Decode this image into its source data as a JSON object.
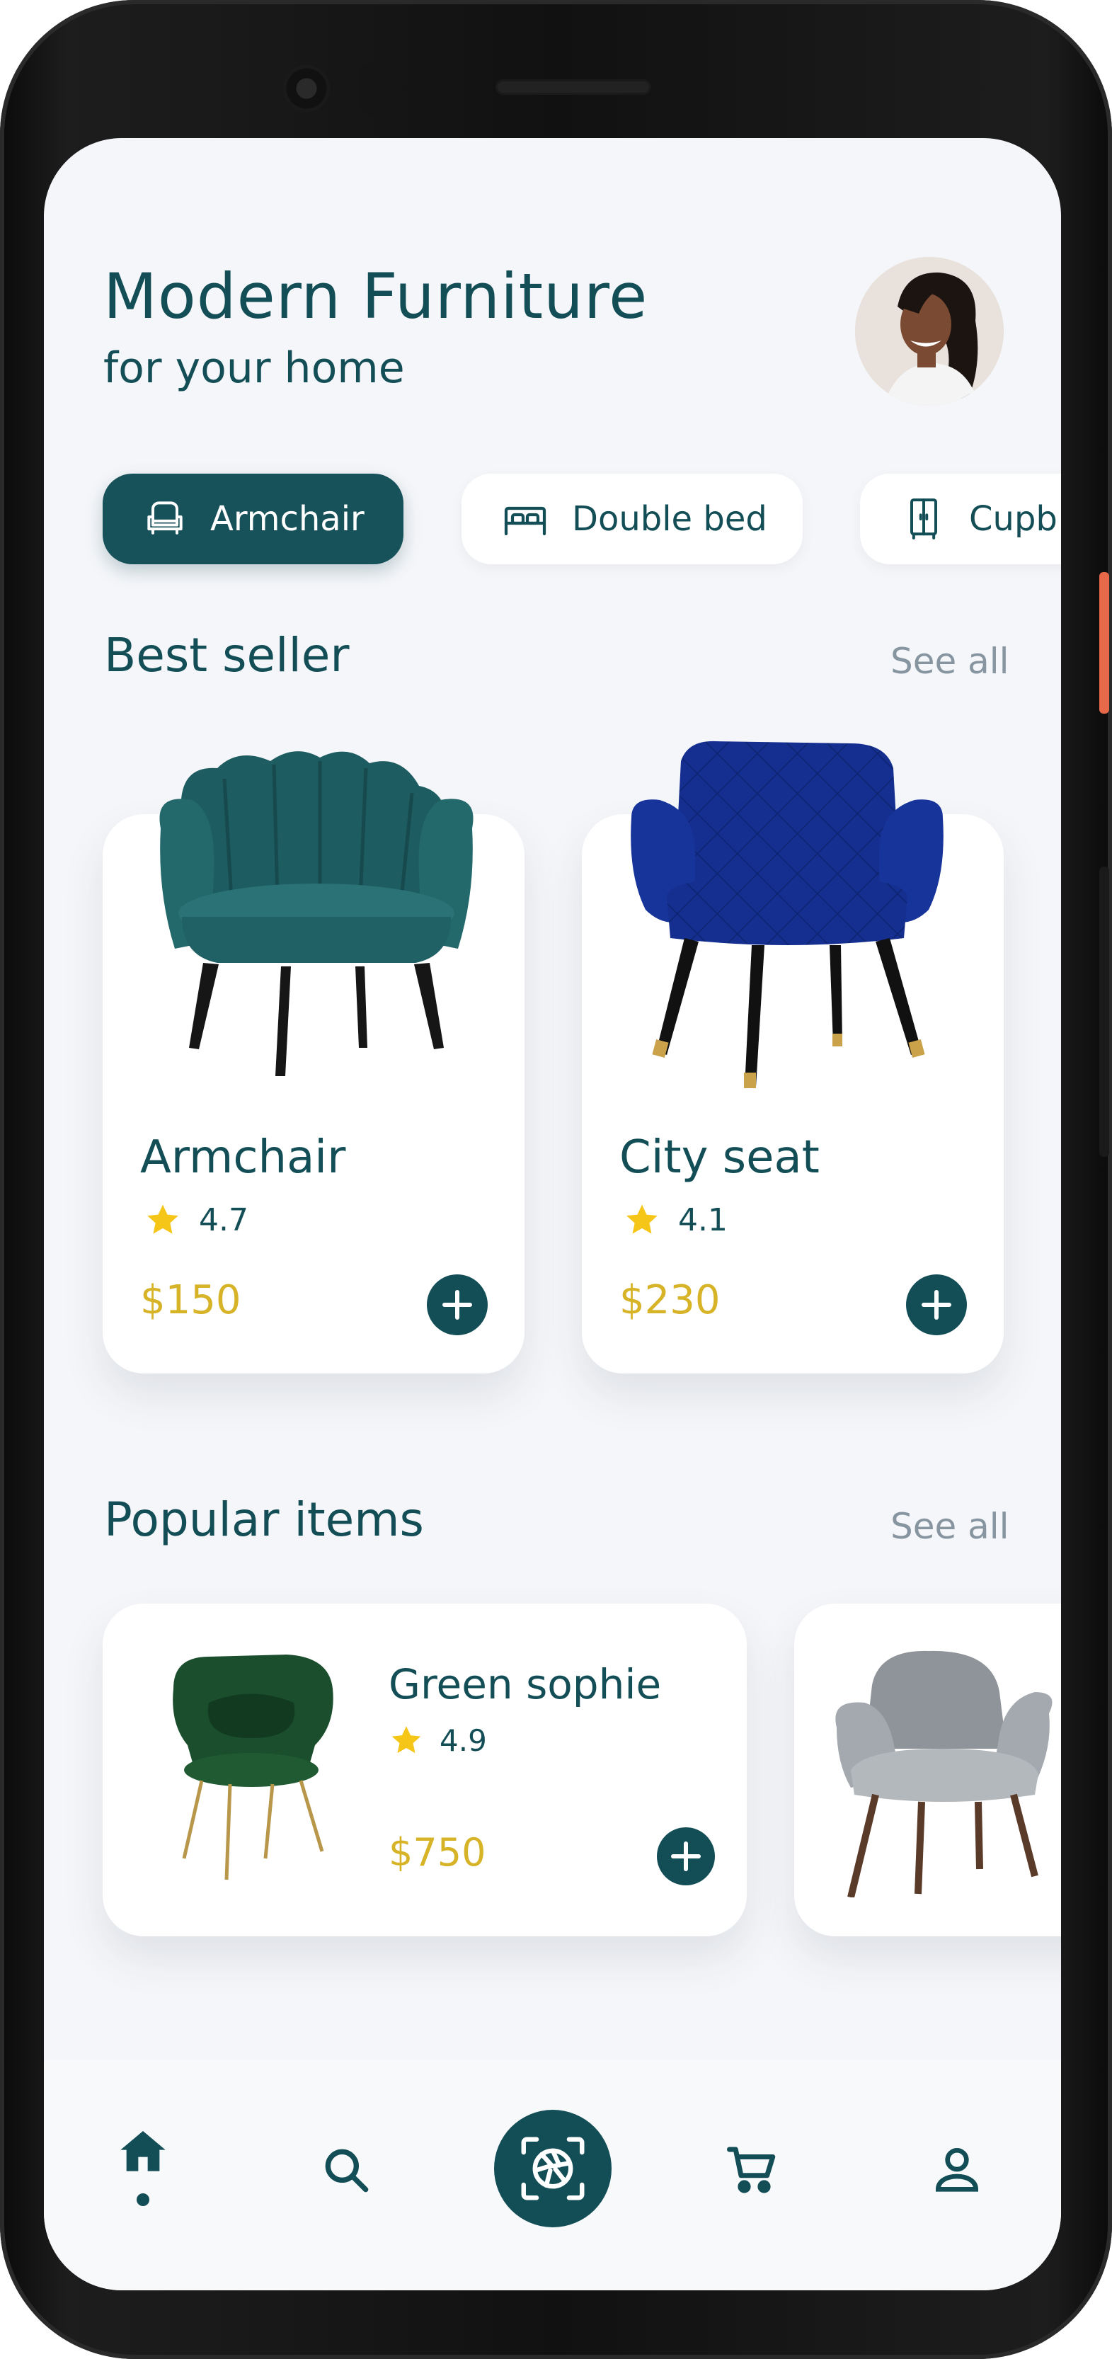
{
  "header": {
    "title": "Modern Furniture",
    "subtitle": "for your home"
  },
  "categories": [
    {
      "label": "Armchair",
      "icon": "armchair-icon",
      "active": true
    },
    {
      "label": "Double bed",
      "icon": "bed-icon",
      "active": false
    },
    {
      "label": "Cupb",
      "icon": "cupboard-icon",
      "active": false
    }
  ],
  "best_seller": {
    "title": "Best seller",
    "see_all": "See all",
    "items": [
      {
        "name": "Armchair",
        "rating": "4.7",
        "price": "$150"
      },
      {
        "name": "City seat",
        "rating": "4.1",
        "price": "$230"
      }
    ]
  },
  "popular": {
    "title": "Popular items",
    "see_all": "See all",
    "items": [
      {
        "name": "Green sophie",
        "rating": "4.9",
        "price": "$750"
      }
    ]
  },
  "nav": {
    "items": [
      "home-icon",
      "search-icon",
      "camera-scan-icon",
      "cart-icon",
      "profile-icon"
    ],
    "active": "home-icon"
  },
  "colors": {
    "primary": "#134e57",
    "price": "#d6b327",
    "star": "#f5c518",
    "muted": "#8795a0",
    "background": "#f5f6f9"
  }
}
